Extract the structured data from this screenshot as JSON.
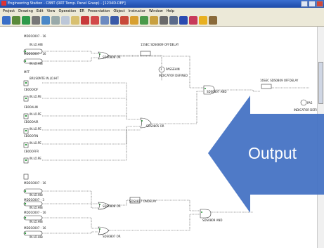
{
  "window": {
    "title": "Engineering Station - C8BT (RRT Temp. Panel Grasp) - [1234D-DEF]"
  },
  "menu": [
    "Project",
    "Drawing",
    "Edit",
    "View",
    "Operation",
    "ER",
    "Presentation",
    "Object",
    "Instructor",
    "Window",
    "Help"
  ],
  "toolbar_icons": [
    "open-book-icon",
    "library-icon",
    "recycle-icon",
    "print-icon",
    "scan-icon",
    "cut-icon",
    "copy-icon",
    "paste-icon",
    "link-icon",
    "key-icon",
    "window-icon",
    "frame-icon",
    "network-icon",
    "chart-icon",
    "settings-icon",
    "gear-icon",
    "grid-icon",
    "monitor-icon",
    "palette-icon",
    "help-icon",
    "broom-icon"
  ],
  "diagram": {
    "inputs": [
      {
        "id": "MI2000T01-01",
        "tag": "MDD10007 -   16",
        "sub": "IN.LO.HIB"
      },
      {
        "id": "MI2000T01-02",
        "tag": "MDD10007 -   16",
        "sub": "IN.LO.HIB"
      },
      {
        "id": "MFT",
        "tag": "MFT",
        "sub": "BRUS0MTE  IN.LO.HIT"
      },
      {
        "id": "CB00OIOF",
        "tag": "CB00OIOF",
        "sub": "IN.LO.PE"
      },
      {
        "id": "CB00ALIN",
        "tag": "CB00ALIN",
        "sub": "IN.LO.PE"
      },
      {
        "id": "CB00OAIR",
        "tag": "CB00OAIR",
        "sub": "IN.LO.PE"
      },
      {
        "id": "CB00OFIN",
        "tag": "CB00OFIN",
        "sub": "IN.LO.PE"
      },
      {
        "id": "CB00OFFR",
        "tag": "CB00OFFR",
        "sub": "IN.LO.PE"
      },
      {
        "id": "MI2000T01-03",
        "tag": "MDD10007 -   16",
        "sub": "IN.LO.HIB"
      },
      {
        "id": "MI2000T01-04",
        "tag": "MDD10007 -   3",
        "sub": "IN.LO.HIB"
      },
      {
        "id": "MI2000T01-05",
        "tag": "MDD10007 -   16",
        "sub": "IN.LO.HIB"
      },
      {
        "id": "MI2000T01-06",
        "tag": "MDD10007 -   16",
        "sub": "IN.LO.HIB"
      }
    ],
    "blocks": {
      "or1": "SDS0808 OR",
      "timer1": "15SEC  SDS0809 OFFDELAY",
      "pass1": "PASSEHIN",
      "indicator1": "INDICATOR DEFINED",
      "and1": "SDS0807 AND",
      "or2": "SDS0805 OR",
      "timer2": "16SEC  SDS0809 OFFDELAY",
      "pass2": "PAS",
      "indicator2": "INDICATOR DEFINED",
      "or3": "SDS0808 OR",
      "delay3": "SDS0817 ONDELAY",
      "or4": "SDS0807 OR",
      "and3": "SDS0809 AND",
      "const1": "1"
    }
  },
  "callout": {
    "text": "Output",
    "color": "#4472C4"
  }
}
